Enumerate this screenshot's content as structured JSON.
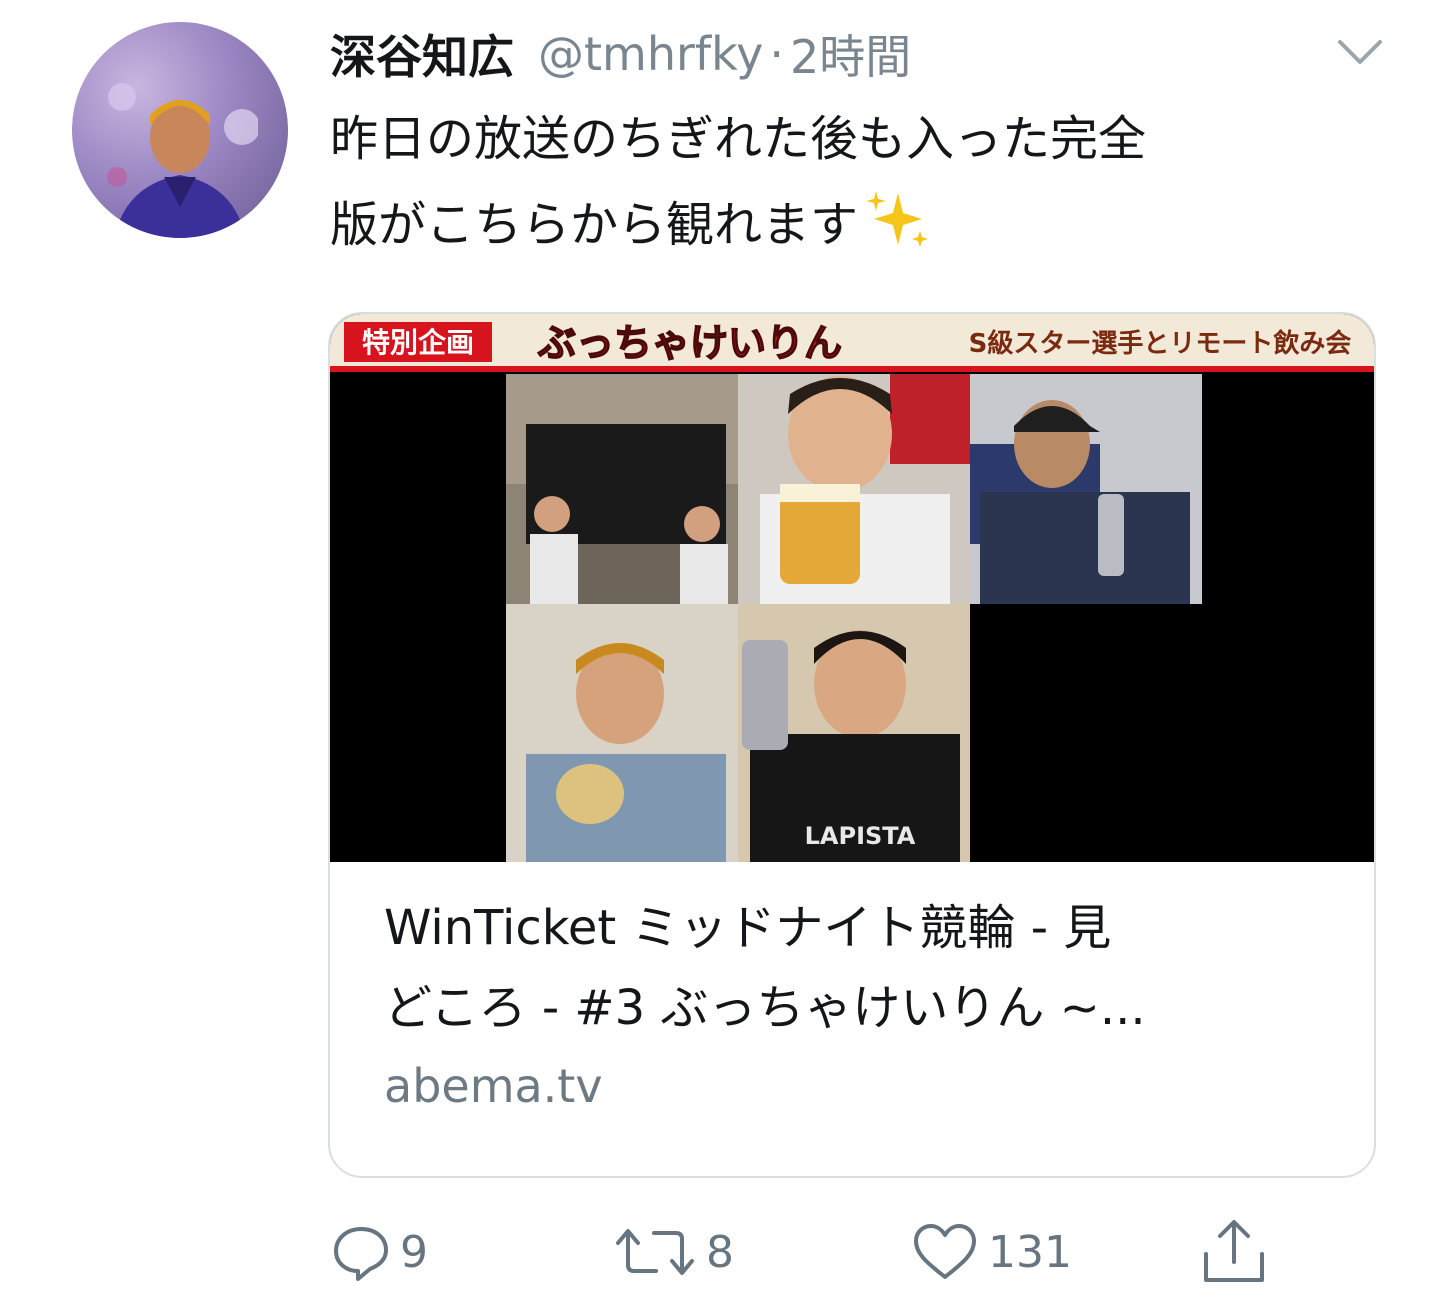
{
  "tweet": {
    "display_name": "深谷知広",
    "handle": "@tmhrfky",
    "separator": "·",
    "time": "2時間",
    "text_line1": "昨日の放送のちぎれた後も入った完全",
    "text_line2": "版がこちらから観れます"
  },
  "card": {
    "banner_label": "特別企画",
    "banner_title": "ぶっちゃけいりん",
    "banner_subtitle": "S級スター選手とリモート飲み会",
    "title_line1": "WinTicket ミッドナイト競輪 - 見",
    "title_line2": "どころ - #3 ぶっちゃけいりん ~...",
    "domain": "abema.tv"
  },
  "actions": {
    "reply_count": "9",
    "retweet_count": "8",
    "like_count": "131"
  },
  "colors": {
    "text": "#14171a",
    "secondary": "#7a868f",
    "border": "#d9dee2",
    "banner_red": "#d7141e"
  },
  "icons": [
    "chevron-down-icon",
    "sparkles-icon",
    "reply-icon",
    "retweet-icon",
    "like-icon",
    "share-icon"
  ]
}
